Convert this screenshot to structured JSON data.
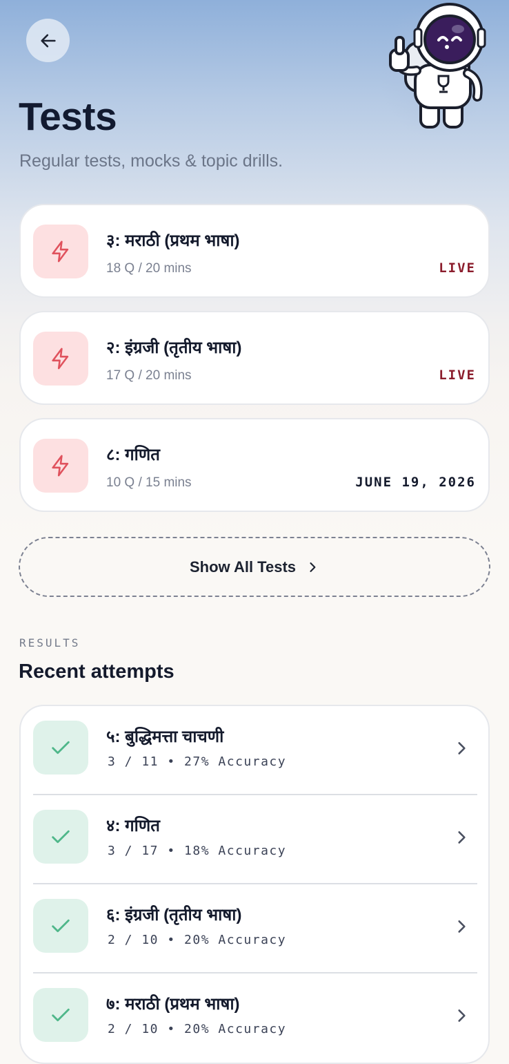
{
  "header": {
    "title": "Tests",
    "subtitle": "Regular tests, mocks & topic drills."
  },
  "tests": [
    {
      "title": "३: मराठी (प्रथम भाषा)",
      "meta": "18 Q / 20 mins",
      "status": "LIVE",
      "status_type": "live"
    },
    {
      "title": "२: इंग्रजी (तृतीय भाषा)",
      "meta": "17 Q / 20 mins",
      "status": "LIVE",
      "status_type": "live"
    },
    {
      "title": "८: गणित",
      "meta": "10 Q / 15 mins",
      "status": "JUNE 19, 2026",
      "status_type": "date"
    }
  ],
  "show_all_label": "Show All Tests",
  "results": {
    "section_label": "RESULTS",
    "title": "Recent attempts",
    "items": [
      {
        "title": "५: बुद्धिमत्ता चाचणी",
        "score": "3 / 11",
        "accuracy": "27% Accuracy"
      },
      {
        "title": "४: गणित",
        "score": "3 / 17",
        "accuracy": "18% Accuracy"
      },
      {
        "title": "६: इंग्रजी (तृतीय भाषा)",
        "score": "2 / 10",
        "accuracy": "20% Accuracy"
      },
      {
        "title": "७: मराठी (प्रथम भाषा)",
        "score": "2 / 10",
        "accuracy": "20% Accuracy"
      }
    ]
  },
  "icons": {
    "back": "arrow-left-icon",
    "test": "lightning-bolt-icon",
    "result": "check-icon",
    "chevron": "chevron-right-icon",
    "mascot": "astronaut-thumbs-up-icon"
  },
  "colors": {
    "live": "#8b1d2c",
    "test_icon_bg": "#fde0e1",
    "test_icon": "#e0525d",
    "result_icon_bg": "#dff2ea",
    "result_icon": "#4fb78a"
  }
}
